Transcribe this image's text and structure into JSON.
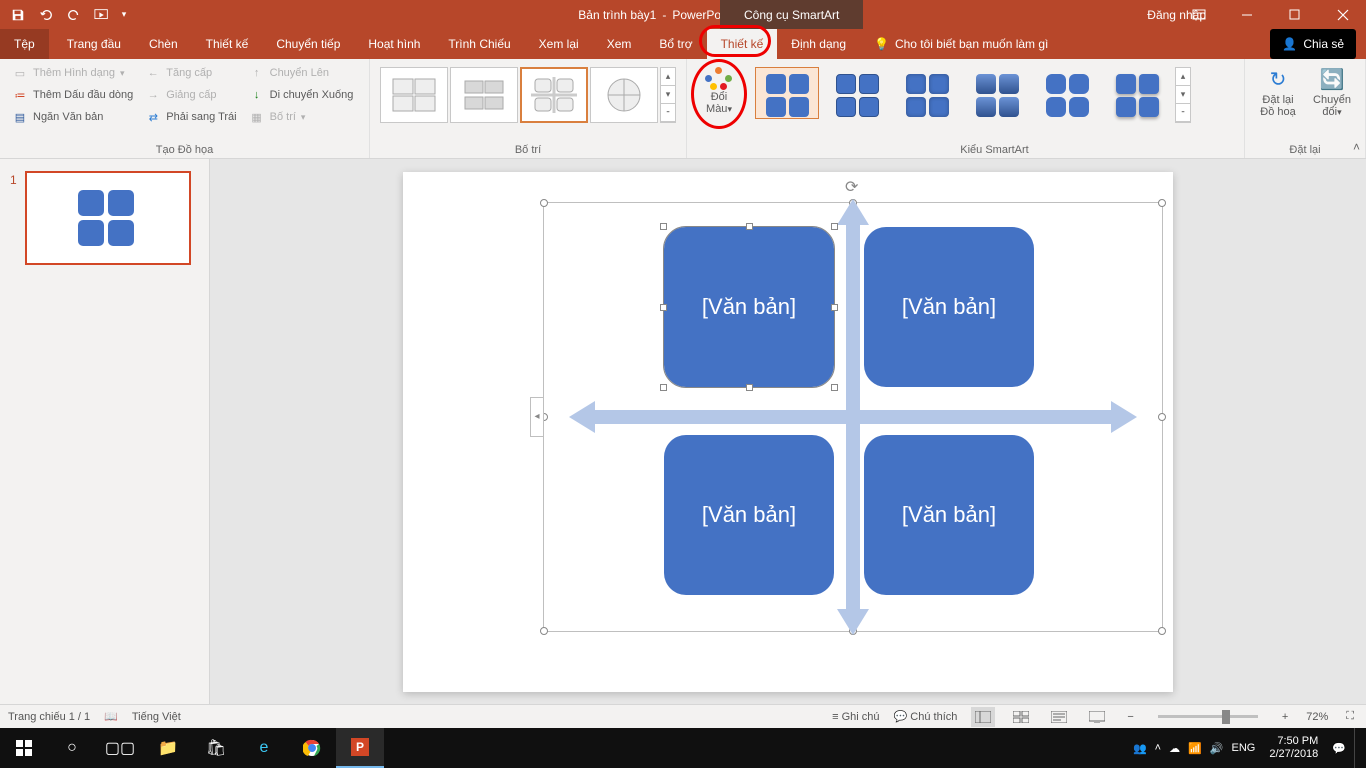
{
  "title": {
    "doc": "Bản trình bày1",
    "sep": "-",
    "app": "PowerPoint"
  },
  "contextTab": "Công cụ SmartArt",
  "signin": "Đăng nhập",
  "tabs": {
    "file": "Tệp",
    "home": "Trang đầu",
    "insert": "Chèn",
    "design": "Thiết kế",
    "transitions": "Chuyển tiếp",
    "animations": "Hoạt hình",
    "slideshow": "Trình Chiếu",
    "review": "Xem lại",
    "view": "Xem",
    "addins": "Bổ trợ",
    "sa_design": "Thiết kế",
    "sa_format": "Định dạng",
    "tellme": "Cho tôi biết bạn muốn làm gì",
    "share": "Chia sẻ"
  },
  "ribbon": {
    "create": {
      "add_shape": "Thêm Hình dạng",
      "add_bullet": "Thêm Dấu đầu dòng",
      "text_pane": "Ngăn Văn bản",
      "promote": "Tăng cấp",
      "demote": "Giảng cấp",
      "rtl": "Phải sang Trái",
      "move_up": "Chuyển Lên",
      "move_down": "Di chuyển Xuống",
      "layout": "Bố trí",
      "group": "Tạo Đồ họa"
    },
    "layouts_group": "Bố trí",
    "change_colors": {
      "l1": "Đổi",
      "l2": "Màu"
    },
    "styles_group": "Kiểu SmartArt",
    "reset": {
      "reset_graphic_l1": "Đặt lại",
      "reset_graphic_l2": "Đồ hoạ",
      "convert_l1": "Chuyển",
      "convert_l2": "đổi",
      "group": "Đặt lại"
    }
  },
  "smartart": {
    "placeholder": "[Văn bản]"
  },
  "slidepanel": {
    "num": "1"
  },
  "status": {
    "slide": "Trang chiếu 1 / 1",
    "lang": "Tiếng Việt",
    "notes": "Ghi chú",
    "comments": "Chú thích",
    "zoom": "72%"
  },
  "taskbar": {
    "lang": "ENG",
    "time": "7:50 PM",
    "date": "2/27/2018"
  }
}
